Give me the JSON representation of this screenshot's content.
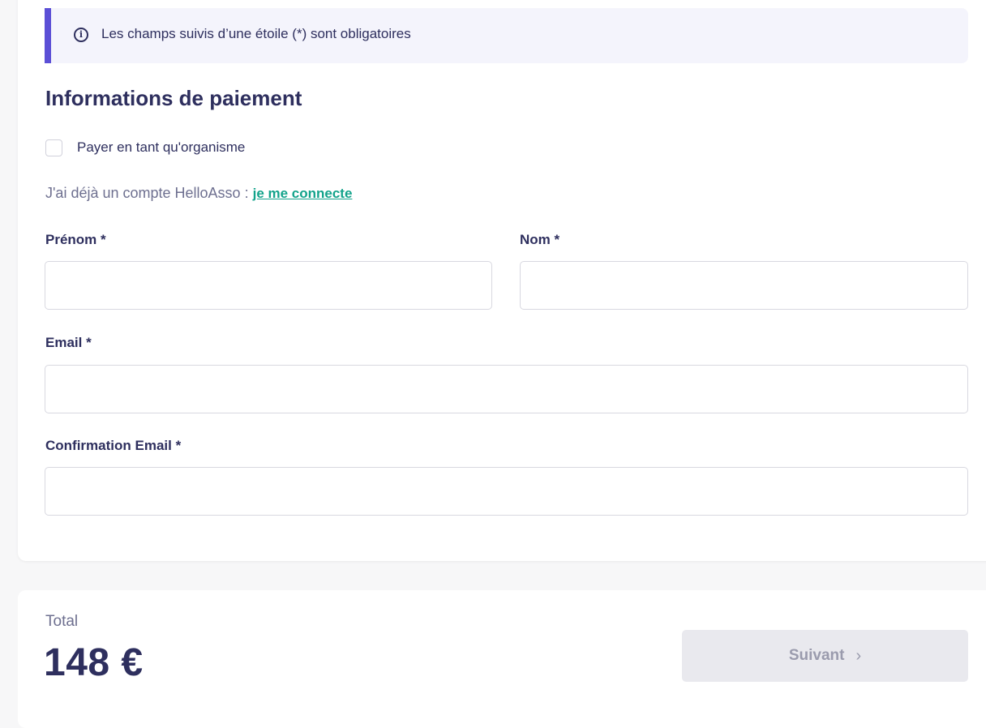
{
  "info_banner": {
    "icon": "info-icon",
    "icon_glyph": "i",
    "text": "Les champs suivis d’une étoile (*) sont obligatoires"
  },
  "payment": {
    "title": "Informations de paiement",
    "organism_checkbox": {
      "label": "Payer en tant qu'organisme",
      "checked": false
    },
    "account_prompt": "J'ai déjà un compte HelloAsso :",
    "account_link": "je me connecte",
    "fields": {
      "first_name": {
        "label": "Prénom *",
        "value": "",
        "placeholder": ""
      },
      "last_name": {
        "label": "Nom *",
        "value": "",
        "placeholder": ""
      },
      "email": {
        "label": "Email *",
        "value": "",
        "placeholder": ""
      },
      "email_confirm": {
        "label": "Confirmation Email *",
        "value": "",
        "placeholder": ""
      }
    }
  },
  "footer": {
    "total_label": "Total",
    "total_amount": "148 €",
    "next_button": {
      "label": "Suivant",
      "icon": "chevron-right-icon",
      "icon_glyph": "›",
      "disabled": true
    }
  },
  "colors": {
    "accent": "#5b4fd6",
    "link": "#13a38b",
    "text_primary": "#2e2f5e",
    "text_muted": "#6e7090",
    "button_disabled_bg": "#e9e9ee"
  }
}
